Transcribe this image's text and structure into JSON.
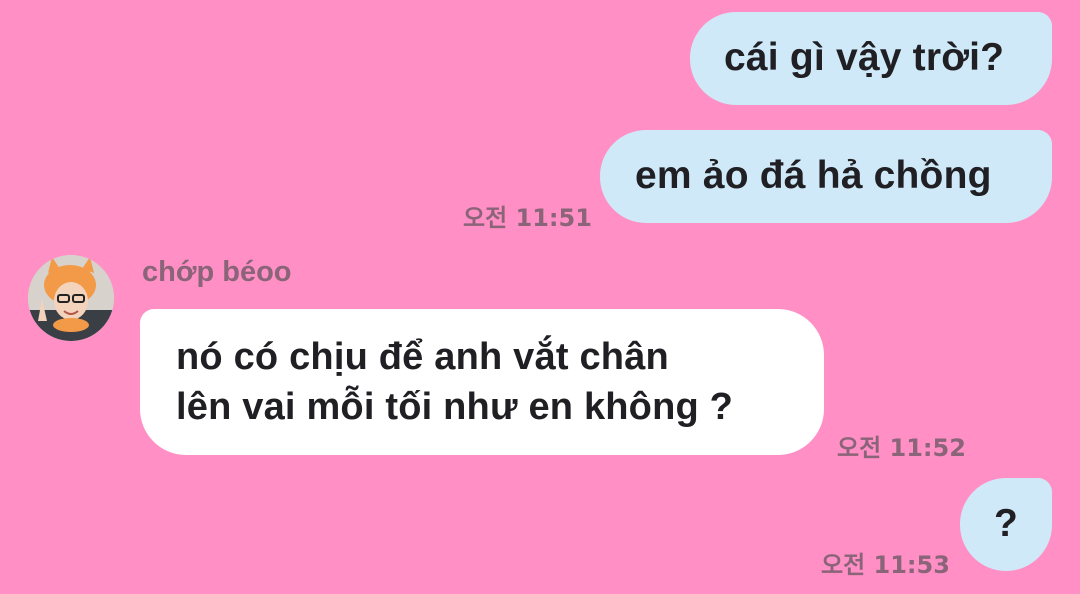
{
  "messages": [
    {
      "sender": "me",
      "text": "cái gì vậy trời?"
    },
    {
      "sender": "me",
      "text": "em ảo đá hả chồng",
      "time": "오전 11:51"
    },
    {
      "sender": "chớp béoo",
      "lines": [
        "nó có chịu để anh vắt chân",
        "lên vai mỗi tối như en không ?"
      ],
      "time": "오전 11:52"
    },
    {
      "sender": "me",
      "text": "?",
      "time": "오전 11:53"
    }
  ],
  "contact": {
    "name": "chớp béoo",
    "avatar_icon": "avatar-photo-icon"
  },
  "colors": {
    "background": "#ff8fc4",
    "outgoing_bubble": "#cfe9f8",
    "incoming_bubble": "#ffffff",
    "meta_text": "#8a6478"
  }
}
